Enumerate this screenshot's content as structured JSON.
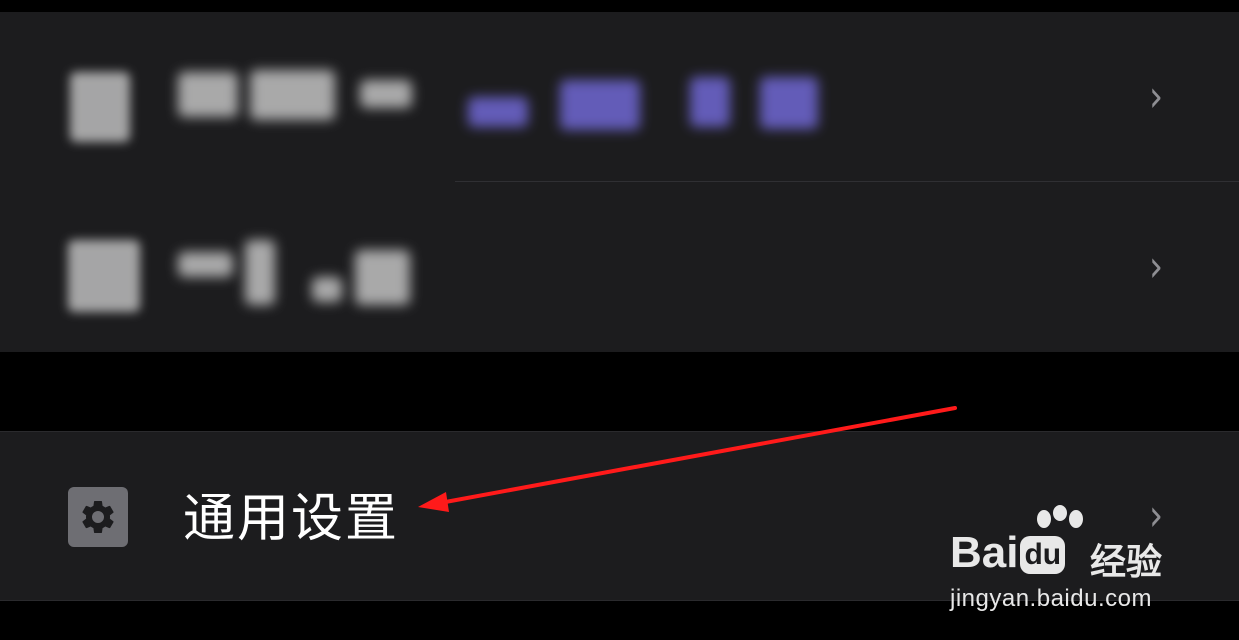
{
  "settings_list": {
    "top_group": {
      "rows": [
        {
          "label": "",
          "redacted": true
        },
        {
          "label": "",
          "redacted": true
        }
      ]
    },
    "general_settings": {
      "icon": "gear-icon",
      "label": "通用设置"
    },
    "chevron_icon": "chevron-right-icon"
  },
  "watermark": {
    "brand_prefix": "Bai",
    "brand_du": "du",
    "brand_suffix": "经验",
    "url": "jingyan.baidu.com"
  },
  "annotation": {
    "arrow_color": "#ff1a1a"
  },
  "colors": {
    "background": "#000000",
    "row_background": "#1c1c1e",
    "icon_background": "#6e6e73",
    "label_text": "#ffffff",
    "chevron": "#8e8e93",
    "redacted_accent": "#6b63c9"
  }
}
